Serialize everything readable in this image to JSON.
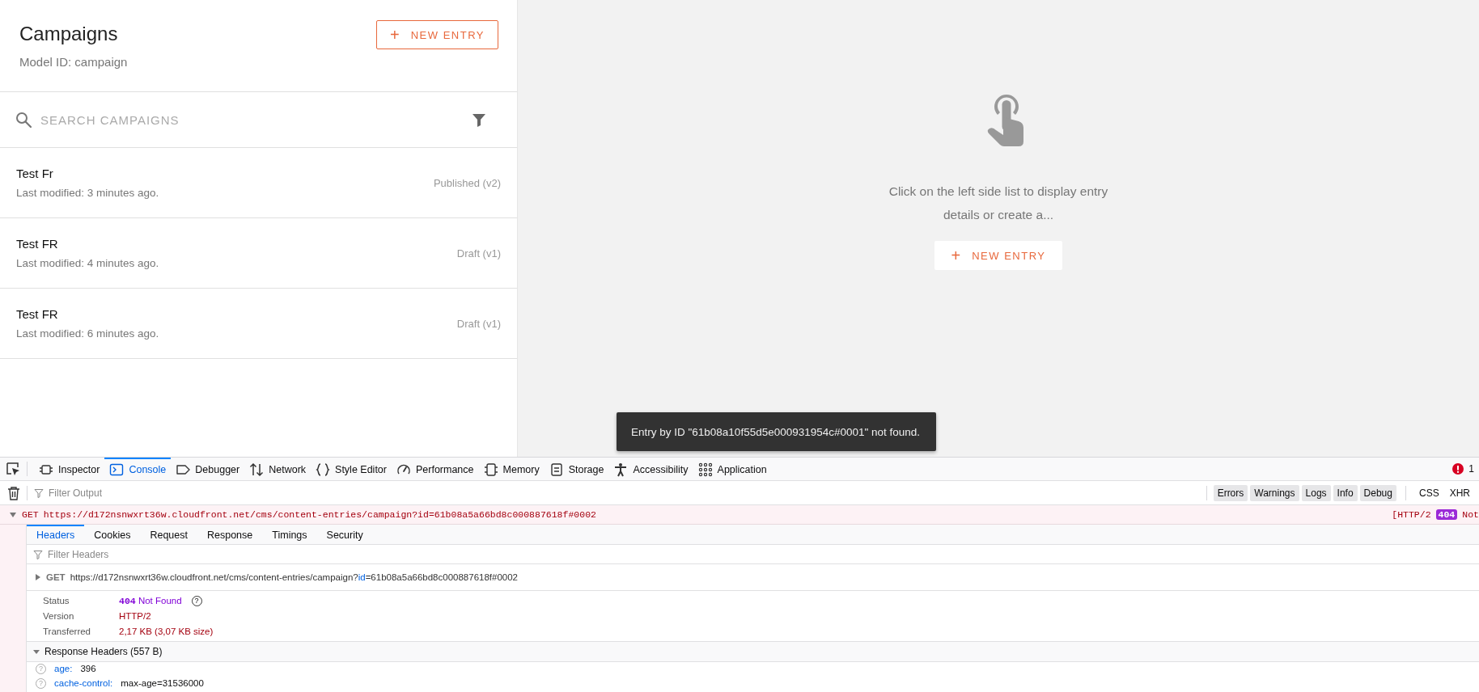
{
  "list_panel": {
    "title": "Campaigns",
    "subtitle": "Model ID: campaign",
    "new_button": {
      "icon": "+",
      "label": "NEW ENTRY"
    },
    "search": {
      "placeholder": "SEARCH CAMPAIGNS"
    },
    "entries": [
      {
        "name": "Test Fr",
        "modified": "Last modified: 3 minutes ago.",
        "status": "Published (v2)"
      },
      {
        "name": "Test FR",
        "modified": "Last modified: 4 minutes ago.",
        "status": "Draft (v1)"
      },
      {
        "name": "Test FR",
        "modified": "Last modified: 6 minutes ago.",
        "status": "Draft (v1)"
      }
    ]
  },
  "detail_panel": {
    "message": "Click on the left side list to display entry details or create a...",
    "new_button": {
      "icon": "+",
      "label": "NEW ENTRY"
    }
  },
  "toast": {
    "message": "Entry by ID \"61b08a10f55d5e000931954c#0001\" not found."
  },
  "devtools": {
    "tabs": [
      {
        "label": "Inspector",
        "selected": false
      },
      {
        "label": "Console",
        "selected": true
      },
      {
        "label": "Debugger",
        "selected": false
      },
      {
        "label": "Network",
        "selected": false
      },
      {
        "label": "Style Editor",
        "selected": false
      },
      {
        "label": "Performance",
        "selected": false
      },
      {
        "label": "Memory",
        "selected": false
      },
      {
        "label": "Storage",
        "selected": false
      },
      {
        "label": "Accessibility",
        "selected": false
      },
      {
        "label": "Application",
        "selected": false
      }
    ],
    "error_count": "1",
    "filter": {
      "placeholder": "Filter Output"
    },
    "levels": [
      {
        "label": "Errors",
        "on": true
      },
      {
        "label": "Warnings",
        "on": true
      },
      {
        "label": "Logs",
        "on": true
      },
      {
        "label": "Info",
        "on": true
      },
      {
        "label": "Debug",
        "on": true
      },
      {
        "label": "CSS",
        "on": false
      },
      {
        "label": "XHR",
        "on": false
      }
    ],
    "request": {
      "method": "GET",
      "url": "https://d172nsnwxrt36w.cloudfront.net/cms/content-entries/campaign?id=61b08a5a66bd8c000887618f#0002",
      "protocol": "[HTTP/2",
      "status_code": "404",
      "status_text": "Not",
      "expanded": true
    },
    "detail_tabs": [
      {
        "label": "Headers",
        "selected": true
      },
      {
        "label": "Cookies",
        "selected": false
      },
      {
        "label": "Request",
        "selected": false
      },
      {
        "label": "Response",
        "selected": false
      },
      {
        "label": "Timings",
        "selected": false
      },
      {
        "label": "Security",
        "selected": false
      }
    ],
    "headers_filter": {
      "placeholder": "Filter Headers"
    },
    "summary": {
      "method": "GET",
      "url_prefix": "https://d172nsnwxrt36w.cloudfront.net/cms/content-entries/campaign?",
      "param_name": "id",
      "url_suffix": "=61b08a5a66bd8c000887618f#0002"
    },
    "status": [
      {
        "kind": "status",
        "label": "Status",
        "code": "404",
        "text": "Not Found",
        "help": "?"
      },
      {
        "kind": "plain",
        "label": "Version",
        "text": "HTTP/2"
      },
      {
        "kind": "plain",
        "label": "Transferred",
        "text": "2,17 KB (3,07 KB size)"
      }
    ],
    "response_headers": {
      "title": "Response Headers (557 B)",
      "expanded": true,
      "items": [
        {
          "help": "?",
          "name": "age:",
          "value": "396"
        },
        {
          "help": "?",
          "name": "cache-control:",
          "value": "max-age=31536000"
        }
      ]
    }
  }
}
